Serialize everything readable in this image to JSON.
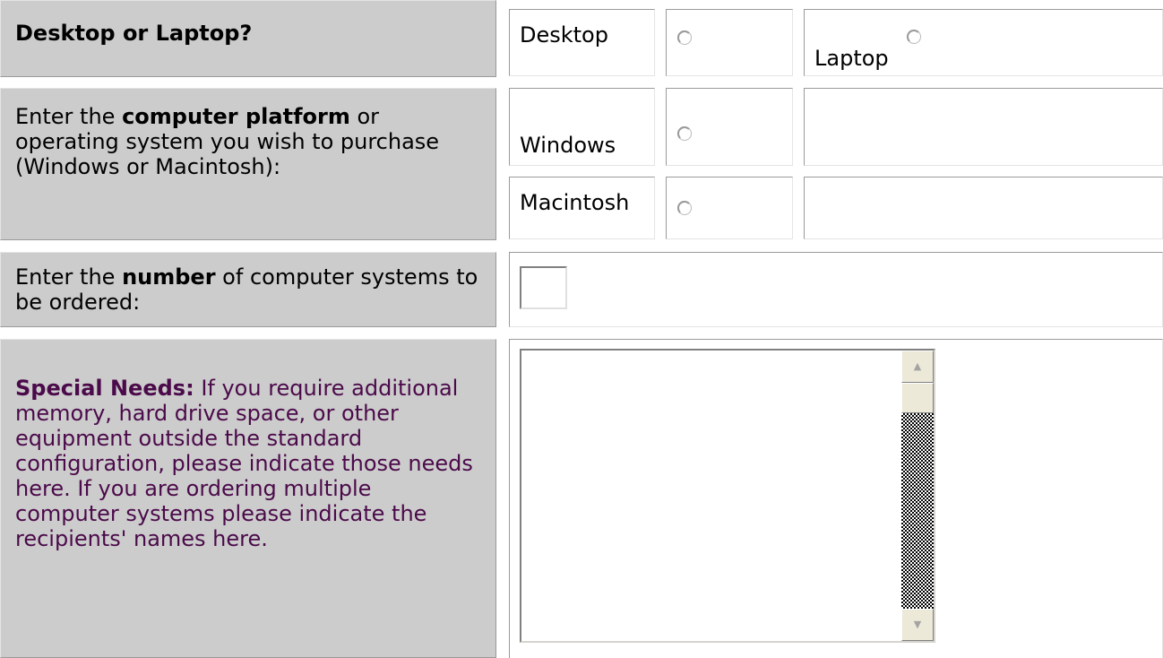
{
  "row1": {
    "label": "Desktop or Laptop?",
    "option_desktop": "Desktop",
    "option_laptop": "Laptop"
  },
  "row2": {
    "label_pre": "Enter the ",
    "label_bold": "computer platform",
    "label_post": " or operating system you wish to purchase (Windows or Macintosh):",
    "option_windows": "Windows",
    "option_macintosh": "Macintosh"
  },
  "row3": {
    "label_pre": "Enter the ",
    "label_bold": "number",
    "label_post": " of computer systems to be ordered:",
    "input_value": ""
  },
  "row4": {
    "label_bold": "Special Needs:",
    "label_text": " If you require additional memory, hard drive space, or other equipment outside the standard configuration, please indicate those needs here. If you are ordering multiple computer systems please indicate the recipients' names here.",
    "textarea_value": ""
  },
  "icons": {
    "scroll_up": "arrow-up-icon",
    "scroll_down": "arrow-down-icon"
  },
  "colors": {
    "label_bg": "#cccccc",
    "special_text": "#4b0a4a"
  }
}
